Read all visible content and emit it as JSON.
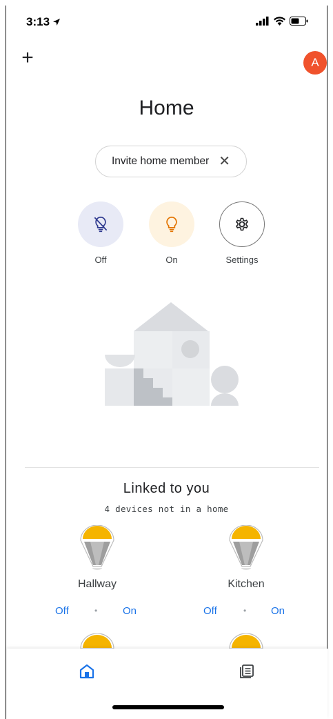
{
  "status_bar": {
    "time": "3:13"
  },
  "header": {
    "title": "Home",
    "avatar_letter": "A"
  },
  "invite_chip": {
    "label": "Invite home member"
  },
  "quick_actions": [
    {
      "label": "Off",
      "icon": "lightbulb-off-icon"
    },
    {
      "label": "On",
      "icon": "lightbulb-icon"
    },
    {
      "label": "Settings",
      "icon": "gear-icon"
    }
  ],
  "linked": {
    "title": "Linked to you",
    "subtitle": "4 devices not in a home",
    "devices": [
      {
        "name": "Hallway",
        "off_label": "Off",
        "on_label": "On"
      },
      {
        "name": "Kitchen",
        "off_label": "Off",
        "on_label": "On"
      }
    ]
  },
  "colors": {
    "accent_blue": "#1a73e8",
    "avatar_bg": "#f0522c",
    "bulb_yellow": "#f5b400",
    "off_circle": "#e8eaf6",
    "on_circle": "#fef3e0"
  }
}
